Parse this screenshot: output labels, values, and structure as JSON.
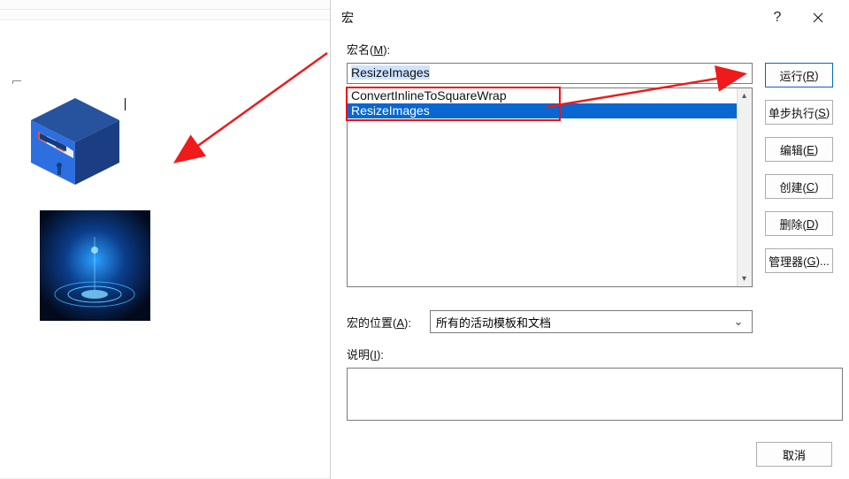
{
  "dialog": {
    "title": "宏",
    "help_tooltip": "?",
    "macro_name_label_pre": "宏名(",
    "macro_name_label_key": "M",
    "macro_name_label_post": "):",
    "macro_name_value": "ResizeImages",
    "macro_list": [
      {
        "label": "ConvertInlineToSquareWrap",
        "selected": false
      },
      {
        "label": "ResizeImages",
        "selected": true
      }
    ],
    "location_label_pre": "宏的位置(",
    "location_label_key": "A",
    "location_label_post": "):",
    "location_value": "所有的活动模板和文档",
    "description_label_pre": "说明(",
    "description_label_key": "I",
    "description_label_post": "):",
    "description_value": "",
    "buttons": {
      "run_pre": "运行(",
      "run_key": "R",
      "run_post": ")",
      "step_pre": "单步执行(",
      "step_key": "S",
      "step_post": ")",
      "edit_pre": "编辑(",
      "edit_key": "E",
      "edit_post": ")",
      "create_pre": "创建(",
      "create_key": "C",
      "create_post": ")",
      "delete_pre": "删除(",
      "delete_key": "D",
      "delete_post": ")",
      "organizer_pre": "管理器(",
      "organizer_key": "G",
      "organizer_post": ")...",
      "cancel": "取消"
    }
  }
}
